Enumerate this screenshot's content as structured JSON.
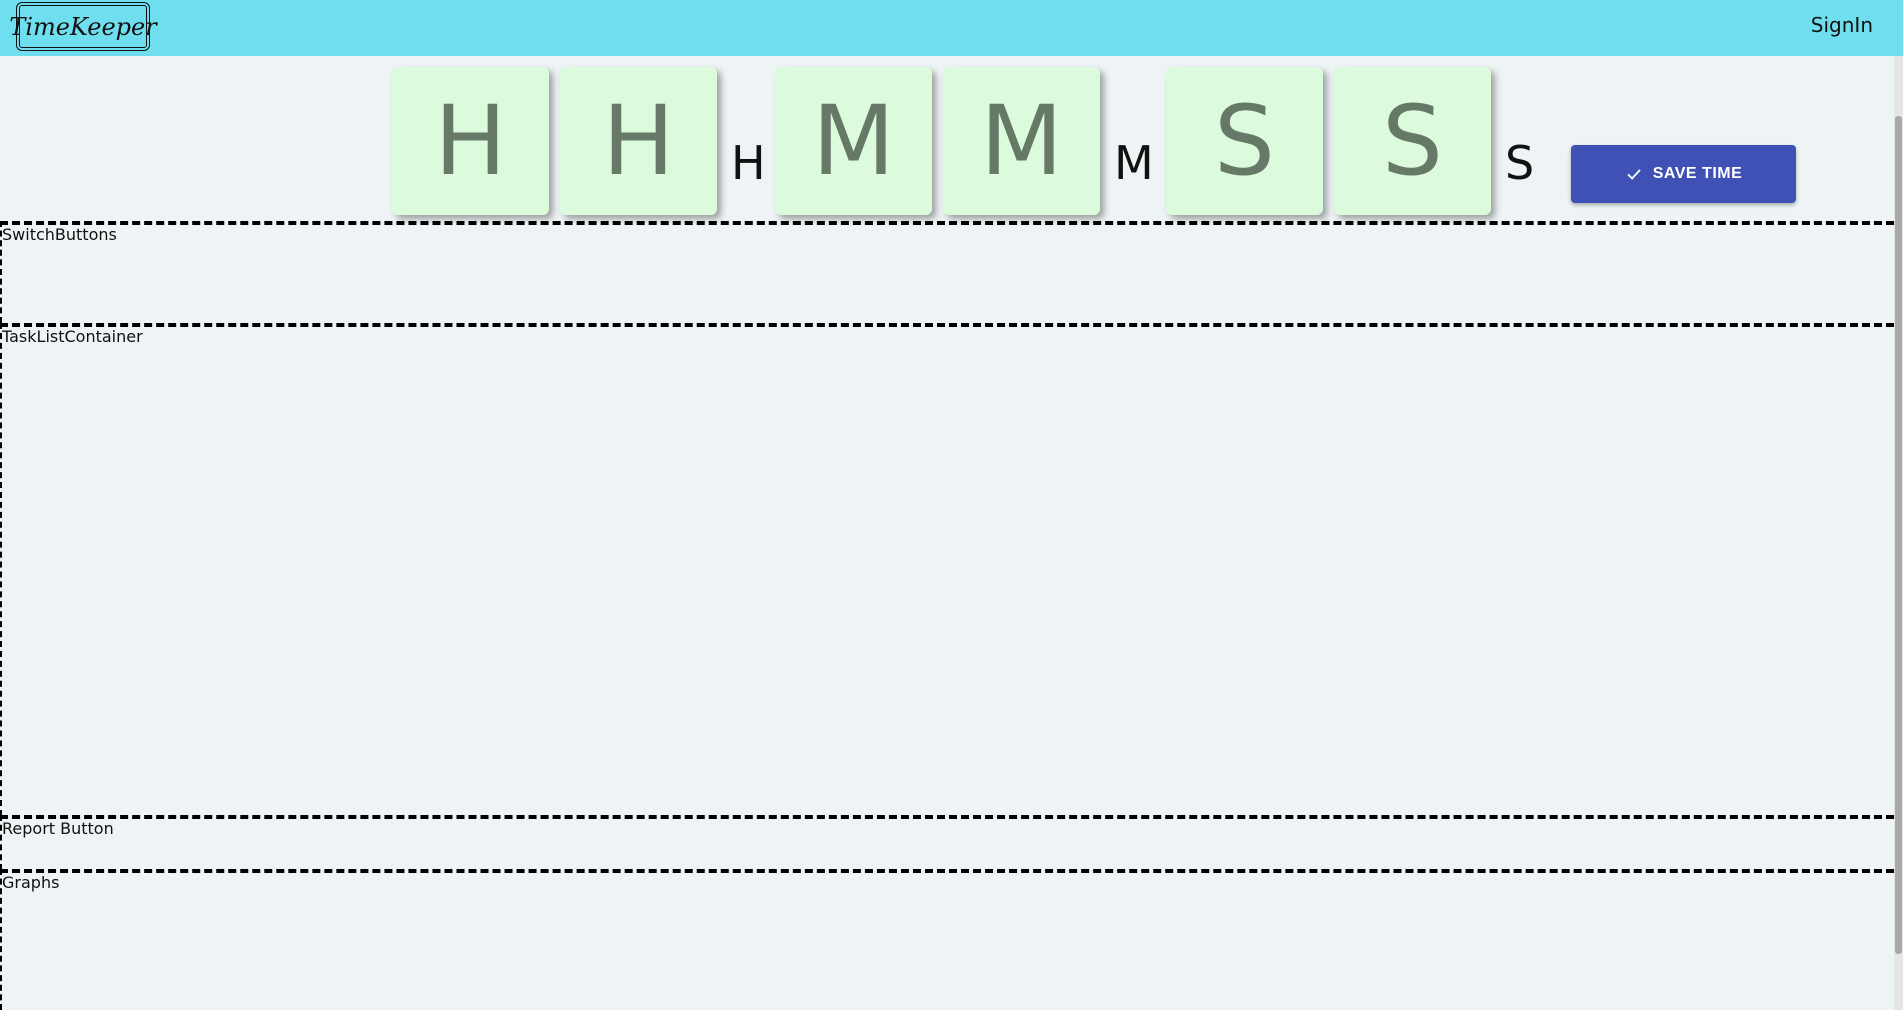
{
  "header": {
    "logo_text": "TimeKeeper",
    "signin_label": "SignIn"
  },
  "timer": {
    "hour_digits": [
      "H",
      "H"
    ],
    "hour_unit": "H",
    "minute_digits": [
      "M",
      "M"
    ],
    "minute_unit": "M",
    "second_digits": [
      "S",
      "S"
    ],
    "second_unit": "S",
    "save_label": "SAVE TIME"
  },
  "sections": {
    "switch_buttons": "SwitchButtons",
    "task_list": "TaskListContainer",
    "report_button": "Report Button",
    "graphs": "Graphs"
  },
  "colors": {
    "topbar": "#6fdff0",
    "tile": "#dcfadc",
    "save_button": "#3f51b5",
    "background": "#eef4f5"
  }
}
